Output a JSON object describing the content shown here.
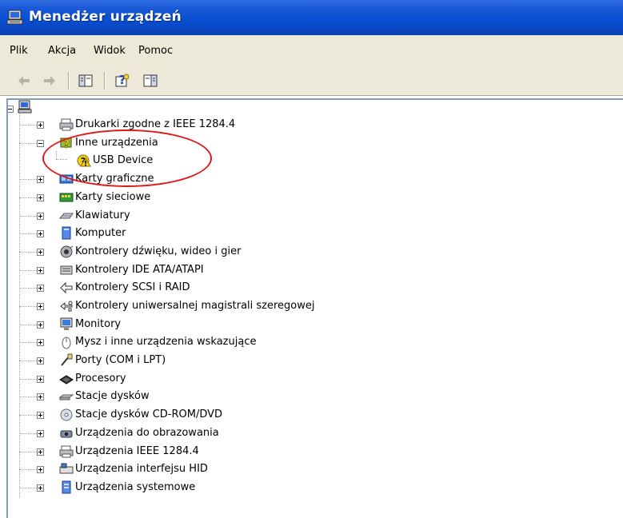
{
  "window": {
    "title": "Menedżer urządzeń"
  },
  "menu": [
    "Plik",
    "Akcja",
    "Widok",
    "Pomoc"
  ],
  "toolbar": [
    "back-icon",
    "forward-icon",
    "properties-icon",
    "help-icon",
    "show-hide-icon"
  ],
  "tree": {
    "root": {
      "icon": "computer-icon",
      "label": ""
    },
    "items": [
      {
        "label": "Drukarki zgodne z IEEE 1284.4",
        "icon": "printer-icon",
        "expanded": false
      },
      {
        "label": "Inne urządzenia",
        "icon": "unknown-device-icon",
        "expanded": true,
        "children": [
          {
            "label": "USB Device",
            "icon": "warning-device-icon"
          }
        ]
      },
      {
        "label": "Karty graficzne",
        "icon": "display-adapter-icon",
        "expanded": false
      },
      {
        "label": "Karty sieciowe",
        "icon": "network-card-icon",
        "expanded": false
      },
      {
        "label": "Klawiatury",
        "icon": "keyboard-icon",
        "expanded": false
      },
      {
        "label": "Komputer",
        "icon": "computer-icon",
        "expanded": false
      },
      {
        "label": "Kontrolery dźwięku, wideo i gier",
        "icon": "sound-icon",
        "expanded": false
      },
      {
        "label": "Kontrolery IDE ATA/ATAPI",
        "icon": "ide-controller-icon",
        "expanded": false
      },
      {
        "label": "Kontrolery SCSI i RAID",
        "icon": "scsi-icon",
        "expanded": false
      },
      {
        "label": "Kontrolery uniwersalnej magistrali szeregowej",
        "icon": "usb-icon",
        "expanded": false
      },
      {
        "label": "Monitory",
        "icon": "monitor-icon",
        "expanded": false
      },
      {
        "label": "Mysz i inne urządzenia wskazujące",
        "icon": "mouse-icon",
        "expanded": false
      },
      {
        "label": "Porty (COM i LPT)",
        "icon": "port-icon",
        "expanded": false
      },
      {
        "label": "Procesory",
        "icon": "processor-icon",
        "expanded": false
      },
      {
        "label": "Stacje dysków",
        "icon": "disk-drive-icon",
        "expanded": false
      },
      {
        "label": "Stacje dysków CD-ROM/DVD",
        "icon": "cdrom-icon",
        "expanded": false
      },
      {
        "label": "Urządzenia do obrazowania",
        "icon": "camera-icon",
        "expanded": false
      },
      {
        "label": "Urządzenia IEEE 1284.4",
        "icon": "printer-icon",
        "expanded": false
      },
      {
        "label": "Urządzenia interfejsu HID",
        "icon": "hid-icon",
        "expanded": false
      },
      {
        "label": "Urządzenia systemowe",
        "icon": "system-device-icon",
        "expanded": false
      }
    ]
  },
  "colors": {
    "titlebar": "#0a4fd2",
    "chrome": "#ece9d8",
    "annotation": "#e01818"
  }
}
